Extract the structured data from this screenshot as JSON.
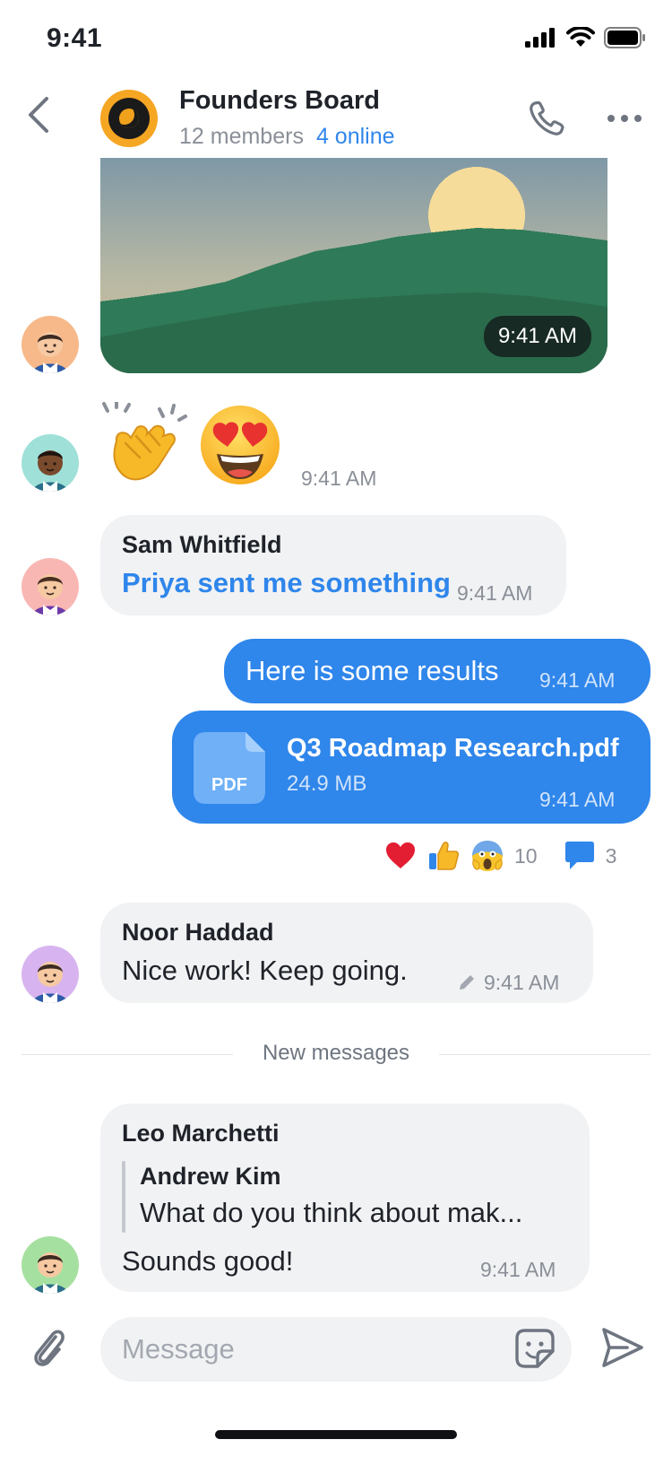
{
  "status_bar": {
    "time": "9:41"
  },
  "header": {
    "title": "Founders Board",
    "members": "12 members",
    "online": "4 online"
  },
  "messages": {
    "image": {
      "time": "9:41 AM"
    },
    "emoji": {
      "time": "9:41 AM"
    },
    "sam": {
      "sender": "Sam Whitfield",
      "text": "Priya sent me something",
      "time": "9:41 AM"
    },
    "results": {
      "text": "Here is some results",
      "time": "9:41 AM"
    },
    "file": {
      "name": "Q3 Roadmap Research.pdf",
      "size": "24.9 MB",
      "badge": "PDF",
      "time": "9:41 AM"
    },
    "reactions": {
      "emoji_count": "10",
      "reply_count": "3"
    },
    "noor": {
      "sender": "Noor Haddad",
      "text": "Nice work! Keep going.",
      "time": "9:41 AM"
    },
    "divider": "New messages",
    "leo": {
      "sender": "Leo Marchetti",
      "quote_sender": "Andrew Kim",
      "quote_text": "What do you think about mak...",
      "text": "Sounds good!",
      "time": "9:41 AM"
    }
  },
  "composer": {
    "placeholder": "Message"
  },
  "colors": {
    "accent": "#2f86eb",
    "bubble_in": "#f1f2f4",
    "text": "#1f2329",
    "muted": "#8a8f98"
  }
}
